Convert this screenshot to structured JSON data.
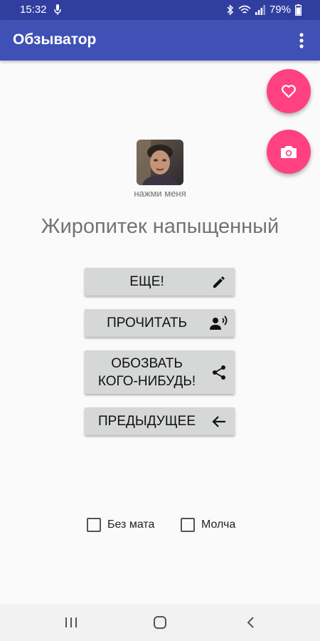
{
  "status": {
    "time": "15:32",
    "battery": "79%"
  },
  "app": {
    "title": "Обзыватор"
  },
  "avatar": {
    "caption": "нажми меня"
  },
  "insult": "Жиропитек напыщенный",
  "buttons": {
    "more": "ЕЩЕ!",
    "read": "ПРОЧИТАТЬ",
    "insult_line1": "ОБОЗВАТЬ",
    "insult_line2": "КОГО-НИБУДЬ!",
    "previous": "ПРЕДЫДУЩЕЕ"
  },
  "options": [
    {
      "label": "Без мата",
      "checked": false
    },
    {
      "label": "Молча",
      "checked": false
    }
  ],
  "colors": {
    "primary": "#3f51b5",
    "primary_dark": "#303f9f",
    "accent": "#ff4081"
  },
  "icons": [
    "mic-icon",
    "bluetooth-icon",
    "wifi-icon",
    "signal-icon",
    "battery-icon",
    "overflow-menu-icon",
    "heart-icon",
    "camera-icon",
    "pencil-icon",
    "record-voice-icon",
    "share-icon",
    "arrow-back-icon",
    "recents-icon",
    "home-icon",
    "back-icon"
  ]
}
